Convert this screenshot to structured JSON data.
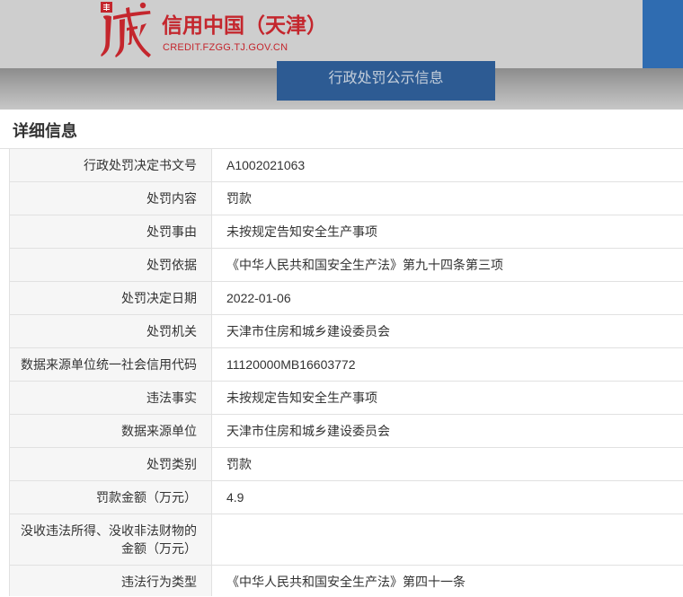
{
  "header": {
    "logo_icon": "credit-china-logo-icon",
    "title": "信用中国（天津）",
    "subtitle": "CREDIT.FZGG.TJ.GOV.CN",
    "nav_tab": "行政处罚公示信息"
  },
  "colors": {
    "brand_red": "#c4262d",
    "nav_blue": "#2d5b93",
    "side_blue": "#2f6cb1"
  },
  "section": {
    "title": "详细信息"
  },
  "details": [
    {
      "label": "行政处罚决定书文号",
      "value": "A1002021063"
    },
    {
      "label": "处罚内容",
      "value": "罚款"
    },
    {
      "label": "处罚事由",
      "value": "未按规定告知安全生产事项"
    },
    {
      "label": "处罚依据",
      "value": "《中华人民共和国安全生产法》第九十四条第三项"
    },
    {
      "label": "处罚决定日期",
      "value": "2022-01-06"
    },
    {
      "label": "处罚机关",
      "value": "天津市住房和城乡建设委员会"
    },
    {
      "label": "数据来源单位统一社会信用代码",
      "value": "11120000MB16603772"
    },
    {
      "label": "违法事实",
      "value": "未按规定告知安全生产事项"
    },
    {
      "label": "数据来源单位",
      "value": "天津市住房和城乡建设委员会"
    },
    {
      "label": "处罚类别",
      "value": "罚款"
    },
    {
      "label": "罚款金额（万元）",
      "value": "4.9"
    },
    {
      "label": "没收违法所得、没收非法财物的金额（万元）",
      "value": ""
    },
    {
      "label": "违法行为类型",
      "value": "《中华人民共和国安全生产法》第四十一条"
    }
  ]
}
